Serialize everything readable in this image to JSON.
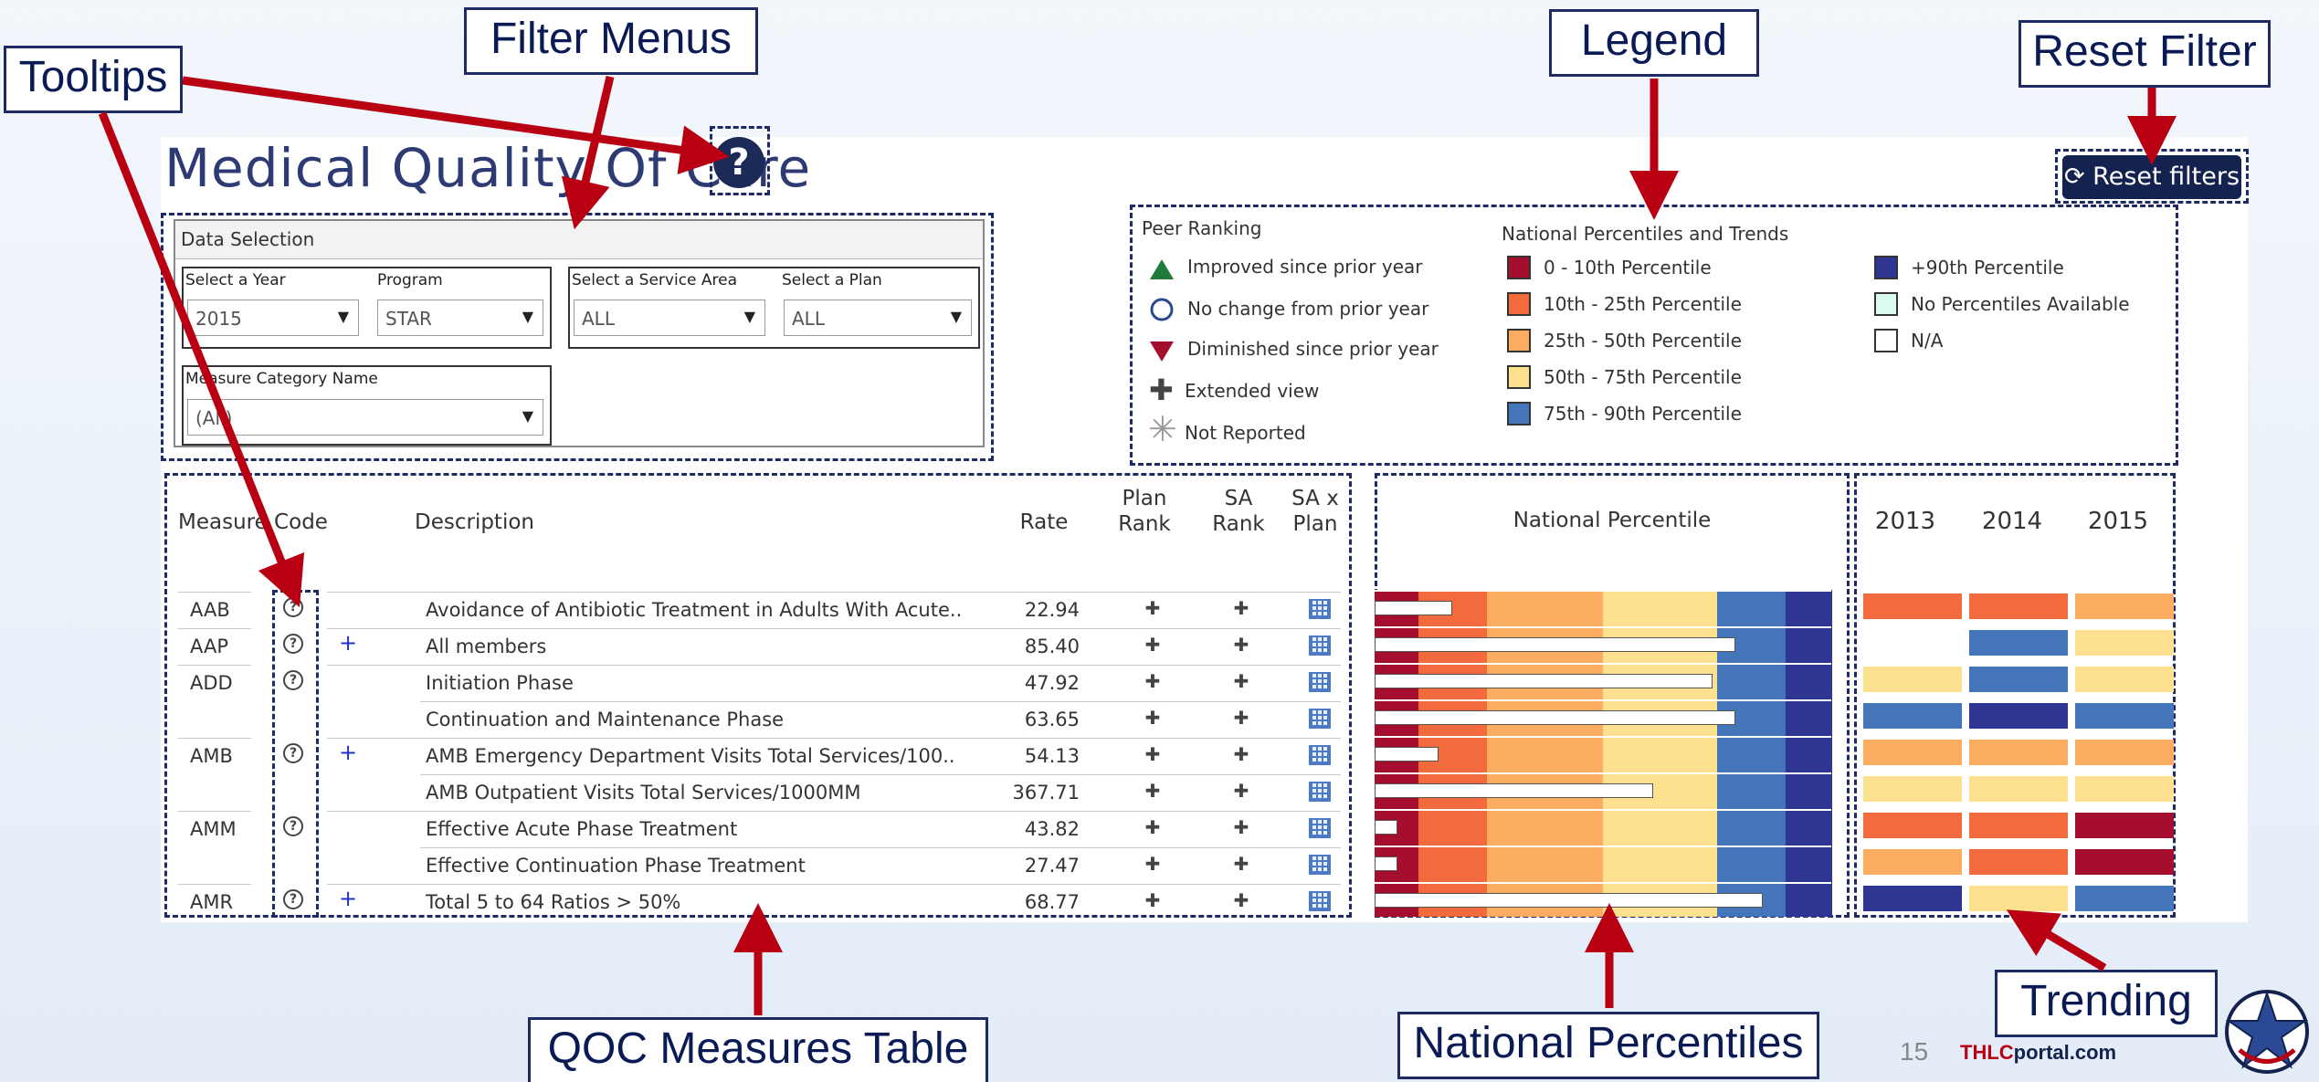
{
  "title": "Medical Quality Of Care",
  "help_icon": "?",
  "reset_button": "Reset filters",
  "callouts": {
    "tooltips": "Tooltips",
    "filter_menus": "Filter Menus",
    "legend": "Legend",
    "reset_filter": "Reset Filter",
    "qoc_table": "QOC Measures Table",
    "national_percentiles": "National Percentiles",
    "trending": "Trending"
  },
  "data_selection": {
    "header": "Data Selection",
    "year_label": "Select a Year",
    "year_value": "2015",
    "program_label": "Program",
    "program_value": "STAR",
    "service_area_label": "Select a Service Area",
    "service_area_value": "ALL",
    "plan_label": "Select a Plan",
    "plan_value": "ALL",
    "measure_cat_label": "Measure Category Name",
    "measure_cat_value": "(All)"
  },
  "legend": {
    "peer_title": "Peer Ranking",
    "peer_items": [
      "Improved since prior year",
      "No change from prior year",
      "Diminished since prior year",
      "Extended view",
      "Not Reported"
    ],
    "national_title": "National Percentiles and Trends",
    "pct_items": [
      {
        "label": "0 - 10th Percentile",
        "color": "#a50f2d"
      },
      {
        "label": "10th - 25th Percentile",
        "color": "#f26b3d"
      },
      {
        "label": "25th - 50th Percentile",
        "color": "#fbac60"
      },
      {
        "label": "50th - 75th Percentile",
        "color": "#fde18f"
      },
      {
        "label": "75th - 90th Percentile",
        "color": "#4575b9"
      },
      {
        "label": "+90th Percentile",
        "color": "#2e3592"
      },
      {
        "label": "No Percentiles Available",
        "color": "#dbfaf2"
      },
      {
        "label": "N/A",
        "color": "#ffffff"
      }
    ]
  },
  "table": {
    "headers": {
      "measure_code": "Measure Code",
      "description": "Description",
      "rate": "Rate",
      "plan_rank": "Plan Rank",
      "sa_rank": "SA Rank",
      "sa_x_plan": "SA x Plan"
    },
    "rows": [
      {
        "code": "AAB",
        "tip": true,
        "ext": false,
        "desc": "Avoidance of Antibiotic Treatment in Adults With Acute..",
        "rate": "22.94",
        "pct": 17,
        "trend": [
          "#f26b3d",
          "#f26b3d",
          "#fbac60"
        ]
      },
      {
        "code": "AAP",
        "tip": true,
        "ext": true,
        "desc": "All members",
        "rate": "85.40",
        "pct": 79,
        "trend": [
          "#ffffff",
          "#4575b9",
          "#fde18f"
        ]
      },
      {
        "code": "ADD",
        "tip": true,
        "ext": false,
        "desc": "Initiation Phase",
        "rate": "47.92",
        "pct": 74,
        "trend": [
          "#fde18f",
          "#4575b9",
          "#fde18f"
        ]
      },
      {
        "code": "",
        "tip": false,
        "ext": false,
        "desc": "Continuation and Maintenance Phase",
        "rate": "63.65",
        "pct": 79,
        "trend": [
          "#4575b9",
          "#2e3592",
          "#4575b9"
        ]
      },
      {
        "code": "AMB",
        "tip": true,
        "ext": true,
        "desc": "AMB Emergency Department  Visits Total Services/100..",
        "rate": "54.13",
        "pct": 14,
        "trend": [
          "#fbac60",
          "#fbac60",
          "#fbac60"
        ]
      },
      {
        "code": "",
        "tip": false,
        "ext": false,
        "desc": "AMB Outpatient Visits Total Services/1000MM",
        "rate": "367.71",
        "pct": 61,
        "trend": [
          "#fde18f",
          "#fde18f",
          "#fde18f"
        ]
      },
      {
        "code": "AMM",
        "tip": true,
        "ext": false,
        "desc": "Effective Acute Phase Treatment",
        "rate": "43.82",
        "pct": 5,
        "trend": [
          "#f26b3d",
          "#f26b3d",
          "#a50f2d"
        ]
      },
      {
        "code": "",
        "tip": false,
        "ext": false,
        "desc": "Effective Continuation Phase Treatment",
        "rate": "27.47",
        "pct": 5,
        "trend": [
          "#fbac60",
          "#f26b3d",
          "#a50f2d"
        ]
      },
      {
        "code": "AMR",
        "tip": true,
        "ext": true,
        "desc": "Total 5 to 64 Ratios > 50%",
        "rate": "68.77",
        "pct": 85,
        "trend": [
          "#2e3592",
          "#fde18f",
          "#4575b9"
        ]
      }
    ]
  },
  "national_title": "National Percentile",
  "years": [
    "2013",
    "2014",
    "2015"
  ],
  "footer": {
    "page": "15",
    "site_a": "THLC",
    "site_b": "portal.com"
  }
}
